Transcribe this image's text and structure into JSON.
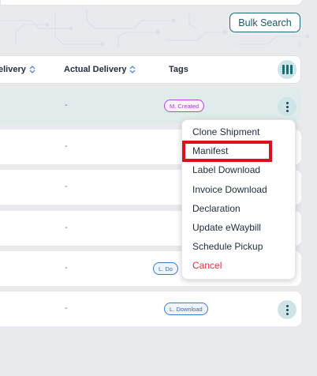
{
  "toolbar": {
    "bulk_search_label": "Bulk Search"
  },
  "table": {
    "columns": [
      "elivery",
      "Actual Delivery",
      "Tags"
    ],
    "rows": [
      {
        "actual_delivery": "-",
        "tag": "M. Created",
        "selected": true
      },
      {
        "actual_delivery": "-",
        "tag": ""
      },
      {
        "actual_delivery": "-",
        "tag": ""
      },
      {
        "actual_delivery": "-",
        "tag": ""
      },
      {
        "actual_delivery": "-",
        "tag": "L. Do"
      },
      {
        "actual_delivery": "-",
        "tag": "L. Download"
      }
    ]
  },
  "menu": {
    "items": [
      "Clone Shipment",
      "Manifest",
      "Label Download",
      "Invoice Download",
      "Declaration",
      "Update eWaybill",
      "Schedule Pickup",
      "Cancel"
    ],
    "highlighted": "Manifest"
  },
  "colors": {
    "accent": "#1a6b73",
    "selected_row": "#dfeceb",
    "danger": "#e0303b",
    "highlight_box": "#e0101b"
  }
}
